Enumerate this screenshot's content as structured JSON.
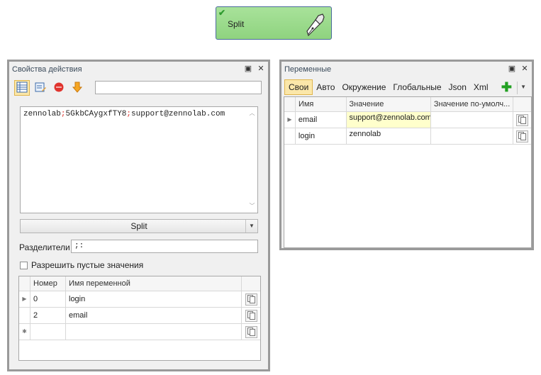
{
  "node": {
    "label": "Split",
    "check_icon": "check-icon",
    "pen_icon": "pen-nib-icon"
  },
  "left_panel": {
    "title": "Свойства действия",
    "pin_icon": "pin-icon",
    "close_icon": "close-icon",
    "toolbar": [
      "grid-view-icon",
      "edit-icon",
      "stop-icon",
      "download-arrow-icon"
    ],
    "input_text": "zennolab;5GkbCAygxfTY8;support@zennolab.com",
    "operation": "Split",
    "separators_label": "Разделители",
    "separators_value": ";:",
    "allow_empty_label": "Разрешить пустые значения",
    "grid": {
      "headers": [
        "Номер",
        "Имя переменной"
      ],
      "rows": [
        {
          "num": "0",
          "name": "login"
        },
        {
          "num": "2",
          "name": "email"
        }
      ]
    }
  },
  "right_panel": {
    "title": "Переменные",
    "tabs": [
      "Свои",
      "Авто",
      "Окружение",
      "Глобальные",
      "Json",
      "Xml"
    ],
    "active_tab": "Свои",
    "grid": {
      "headers": [
        "Имя",
        "Значение",
        "Значение по-умолч..."
      ],
      "rows": [
        {
          "name": "email",
          "value": "support@zennolab.com",
          "default": ""
        },
        {
          "name": "login",
          "value": "zennolab",
          "default": ""
        }
      ]
    }
  },
  "colors": {
    "node_green": "#9cdb8c",
    "node_border": "#4a6a9c",
    "active_tab_bg": "#fbe7a9",
    "value_highlight": "#ffffcc",
    "input_separator_highlight": "#e0342e"
  }
}
